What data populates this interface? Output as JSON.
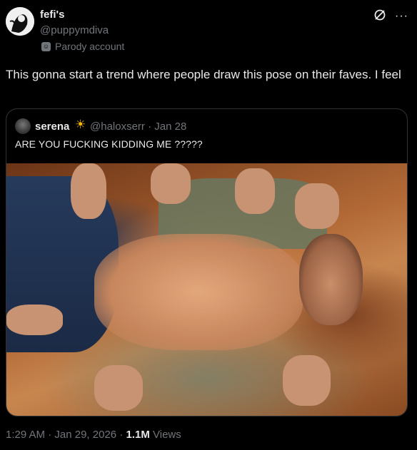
{
  "author": {
    "display_name": "fefi's",
    "handle": "@puppymdiva",
    "label": "Parody account"
  },
  "icons": {
    "grok": "grok-icon",
    "more": "more-icon",
    "parody": "parody-mask-icon",
    "sun": "sun-emoji-icon"
  },
  "tweet": {
    "text": "This gonna start a trend where people draw this pose on their faves. I feel"
  },
  "quoted": {
    "display_name": "serena",
    "handle": "@haloxserr",
    "separator": "·",
    "date": "Jan 28",
    "text": "ARE YOU FUCKING KIDDING ME ?????"
  },
  "footer": {
    "time": "1:29 AM",
    "separator": "·",
    "date": "Jan 29, 2026",
    "separator2": "·",
    "views_count": "1.1M",
    "views_label": "Views"
  },
  "colors": {
    "background": "#000000",
    "text_primary": "#e7e9ea",
    "text_secondary": "#71767b",
    "border": "#2f3336"
  }
}
